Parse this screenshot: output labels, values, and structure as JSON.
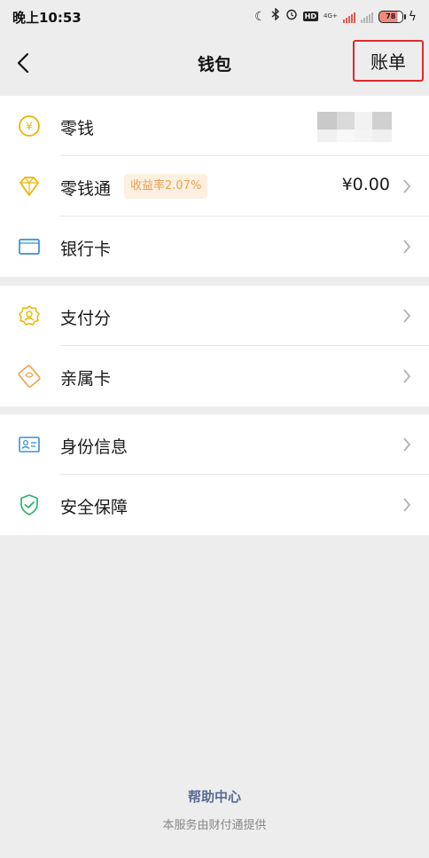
{
  "status_bar": {
    "time": "晚上10:53",
    "network": "4G+",
    "battery": "78"
  },
  "header": {
    "title": "钱包",
    "bill_label": "账单"
  },
  "wallet_groups": [
    {
      "items": [
        {
          "label": "零钱",
          "icon": "yuan-coin-icon",
          "value_hidden": true
        },
        {
          "label": "零钱通",
          "icon": "diamond-icon",
          "badge": "收益率2.07%",
          "value": "¥0.00"
        },
        {
          "label": "银行卡",
          "icon": "bank-card-icon"
        }
      ]
    },
    {
      "items": [
        {
          "label": "支付分",
          "icon": "pay-score-icon"
        },
        {
          "label": "亲属卡",
          "icon": "family-card-icon"
        }
      ]
    },
    {
      "items": [
        {
          "label": "身份信息",
          "icon": "id-card-icon"
        },
        {
          "label": "安全保障",
          "icon": "shield-check-icon"
        }
      ]
    }
  ],
  "footer": {
    "help_center": "帮助中心",
    "provider_note": "本服务由财付通提供"
  },
  "colors": {
    "accent_yellow": "#f0b400",
    "bank_blue": "#3a8fd8",
    "security_green": "#2fb36b",
    "link_blue": "#576b95",
    "highlight_red": "#e0292b"
  }
}
